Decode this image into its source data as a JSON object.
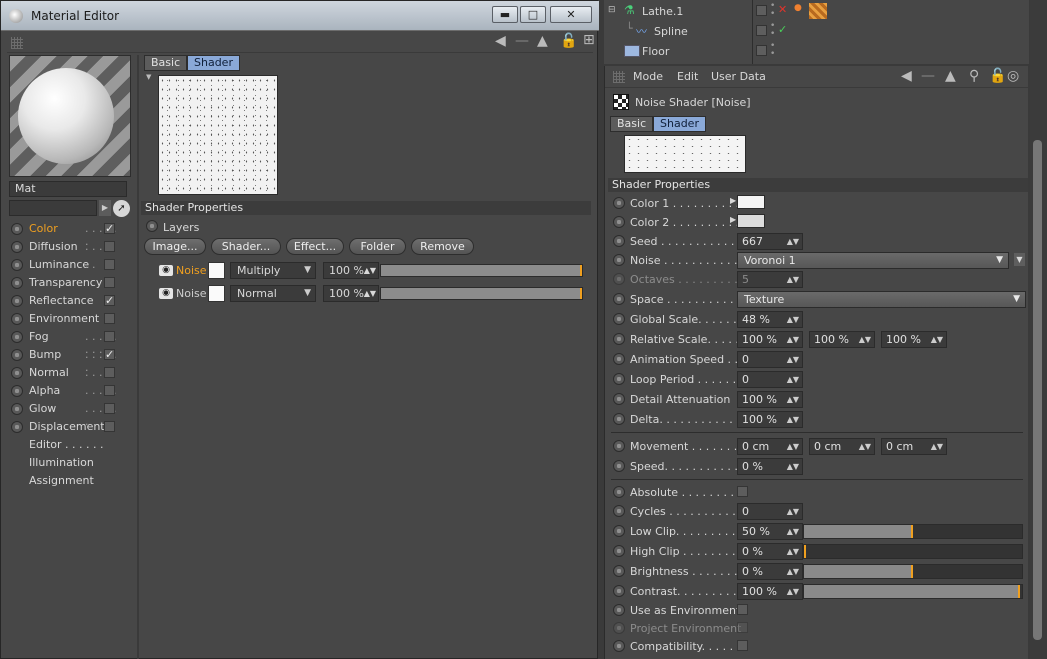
{
  "material_editor": {
    "title": "Material Editor",
    "minimize": "▬",
    "maximize": "□",
    "close": "✕",
    "material_name": "Mat",
    "channels": [
      {
        "label": "Color",
        "dots": ". . . . . .",
        "checked": "✓",
        "selected": true
      },
      {
        "label": "Diffusion",
        "dots": ". . .",
        "checked": ""
      },
      {
        "label": "Luminance",
        "dots": ". .",
        "checked": ""
      },
      {
        "label": "Transparency",
        "dots": "",
        "checked": ""
      },
      {
        "label": "Reflectance",
        "dots": "",
        "checked": "✓"
      },
      {
        "label": "Environment",
        "dots": "",
        "checked": ""
      },
      {
        "label": "Fog",
        "dots": ". . . . . . . .",
        "checked": ""
      },
      {
        "label": "Bump",
        "dots": ". . . . . .",
        "checked": "✓"
      },
      {
        "label": "Normal",
        "dots": ". . . .",
        "checked": ""
      },
      {
        "label": "Alpha",
        "dots": ". . . . .",
        "checked": ""
      },
      {
        "label": "Glow",
        "dots": ". . . . . .",
        "checked": ""
      },
      {
        "label": "Displacement",
        "dots": "",
        "checked": ""
      }
    ],
    "extra_items": [
      {
        "label": "Editor . . . . . ."
      },
      {
        "label": "Illumination"
      },
      {
        "label": "Assignment"
      }
    ],
    "tabs": {
      "basic": "Basic",
      "shader": "Shader"
    },
    "shader_properties": "Shader Properties",
    "layers_label": "Layers",
    "buttons": {
      "image": "Image...",
      "shader": "Shader...",
      "effect": "Effect...",
      "folder": "Folder",
      "remove": "Remove"
    },
    "layers": [
      {
        "name": "Noise",
        "mode": "Multiply",
        "opacity": "100 %",
        "active": true,
        "level": 1.0
      },
      {
        "name": "Noise",
        "mode": "Normal",
        "opacity": "100 %",
        "active": false,
        "level": 1.0
      }
    ]
  },
  "object_manager": {
    "rows": [
      {
        "name": "Lathe.1"
      },
      {
        "name": "Spline",
        "check": "✓"
      },
      {
        "name": "Floor"
      }
    ]
  },
  "attributes": {
    "menu": [
      "Mode",
      "Edit",
      "User Data"
    ],
    "header": "Noise Shader [Noise]",
    "tabs": {
      "basic": "Basic",
      "shader": "Shader"
    },
    "section": "Shader Properties",
    "color1": {
      "label": "Color 1 . . . . . . . . . .",
      "value": "#f4f4f4"
    },
    "color2": {
      "label": "Color 2 . . . . . . . . . .",
      "value": "#dcdcdc"
    },
    "seed": {
      "label": "Seed . . . . . . . . . . . . .",
      "value": "667"
    },
    "noise": {
      "label": "Noise . . . . . . . . . . . .",
      "value": "Voronoi 1"
    },
    "octaves": {
      "label": "Octaves . . . . . . . . .",
      "value": "5"
    },
    "space": {
      "label": "Space . . . . . . . . . . . .",
      "value": "Texture"
    },
    "global_scale": {
      "label": "Global Scale. . . . . . .",
      "value": "48 %"
    },
    "relative_scale": {
      "label": "Relative Scale. . . . . .",
      "values": [
        "100 %",
        "100 %",
        "100 %"
      ]
    },
    "animation_speed": {
      "label": "Animation Speed . .",
      "value": "0"
    },
    "loop_period": {
      "label": "Loop Period . . . . . . .",
      "value": "0"
    },
    "detail_attenuation": {
      "label": "Detail Attenuation",
      "value": "100 %"
    },
    "delta": {
      "label": "Delta. . . . . . . . . . . . .",
      "value": "100 %"
    },
    "movement": {
      "label": "Movement . . . . . . . .",
      "values": [
        "0 cm",
        "0 cm",
        "0 cm"
      ]
    },
    "speed": {
      "label": "Speed. . . . . . . . . . . .",
      "value": "0 %"
    },
    "absolute": {
      "label": "Absolute . . . . . . . . ."
    },
    "cycles": {
      "label": "Cycles . . . . . . . . . . .",
      "value": "0"
    },
    "low_clip": {
      "label": "Low Clip. . . . . . . . . .",
      "value": "50 %",
      "level": 0.5
    },
    "high_clip": {
      "label": "High Clip . . . . . . . . .",
      "value": "0 %",
      "level": 0.0
    },
    "brightness": {
      "label": "Brightness . . . . . . . .",
      "value": "0 %",
      "level": 0.5
    },
    "contrast": {
      "label": "Contrast. . . . . . . . . .",
      "value": "100 %",
      "level": 1.0
    },
    "use_as_environment": {
      "label": "Use as Environment"
    },
    "project_environment": {
      "label": "Project Environment"
    },
    "compatibility": {
      "label": "Compatibility. . . . . . ."
    }
  }
}
